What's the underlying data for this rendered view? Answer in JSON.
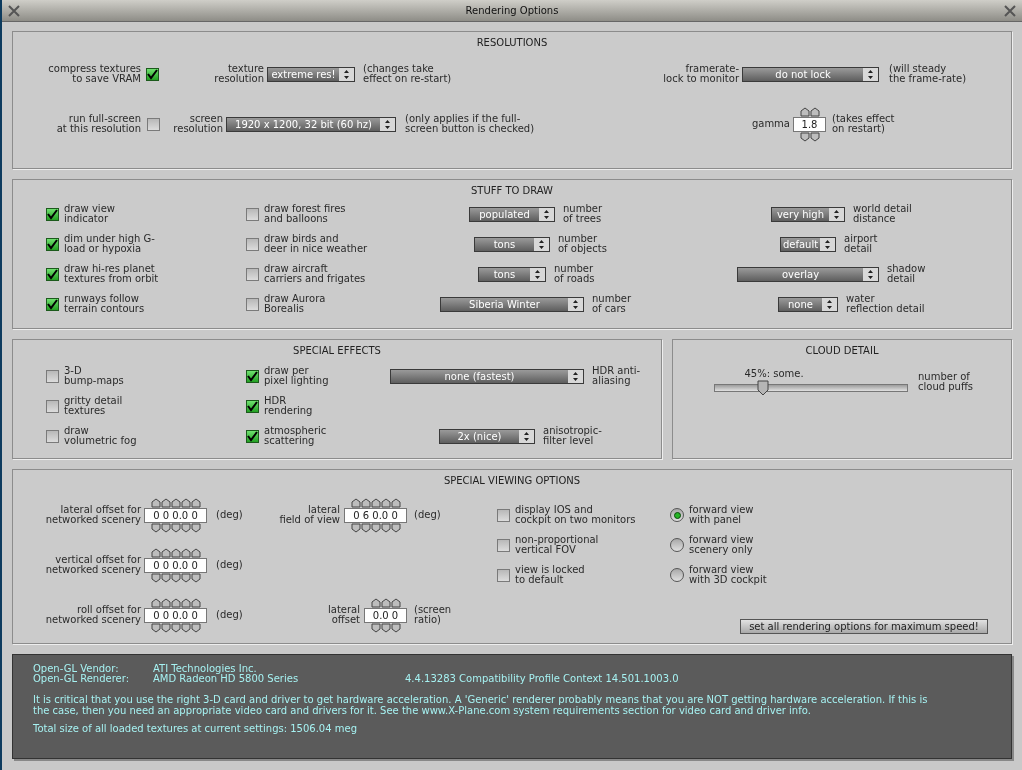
{
  "window": {
    "title": "Rendering Options"
  },
  "resolutions": {
    "title": "RESOLUTIONS",
    "compress_textures": {
      "label": "compress textures\nto save VRAM",
      "checked": true
    },
    "texture_resolution": {
      "label": "texture\nresolution",
      "value": "extreme res!",
      "note": "(changes take\neffect on re-start)"
    },
    "framerate_lock": {
      "label": "framerate-\nlock to monitor",
      "value": "do not lock",
      "note": "(will steady\nthe frame-rate)"
    },
    "run_full_screen": {
      "label": "run full-screen\nat this resolution",
      "checked": false
    },
    "screen_resolution": {
      "label": "screen\nresolution",
      "value": "1920 x 1200, 32 bit (60 hz)",
      "note": "(only applies if the full-\nscreen button is checked)"
    },
    "gamma": {
      "label": "gamma",
      "value": "1.8",
      "note": "(takes effect\non restart)"
    }
  },
  "stuff_to_draw": {
    "title": "STUFF TO DRAW",
    "options_1": [
      {
        "label": "draw view\nindicator",
        "checked": true
      },
      {
        "label": "dim under high G-\nload or hypoxia",
        "checked": true
      },
      {
        "label": "draw hi-res planet\ntextures from orbit",
        "checked": true
      },
      {
        "label": "runways follow\nterrain contours",
        "checked": true
      }
    ],
    "options_2": [
      {
        "label": "draw forest fires\nand balloons",
        "checked": false
      },
      {
        "label": "draw birds and\ndeer in nice weather",
        "checked": false
      },
      {
        "label": "draw aircraft\ncarriers and frigates",
        "checked": false
      },
      {
        "label": "draw Aurora\nBorealis",
        "checked": false
      }
    ],
    "settings_1": [
      {
        "value": "populated",
        "label": "number\nof trees"
      },
      {
        "value": "tons",
        "label": "number\nof objects"
      },
      {
        "value": "tons",
        "label": "number\nof roads"
      },
      {
        "value": "Siberia Winter",
        "label": "number\nof cars"
      }
    ],
    "settings_2": [
      {
        "value": "very high",
        "label": "world detail\ndistance"
      },
      {
        "value": "default",
        "label": "airport\ndetail"
      },
      {
        "value": "overlay",
        "label": "shadow\ndetail"
      },
      {
        "value": "none",
        "label": "water\nreflection detail"
      }
    ]
  },
  "special_effects": {
    "title": "SPECIAL EFFECTS",
    "options_1": [
      {
        "label": "3-D\nbump-maps",
        "checked": false
      },
      {
        "label": "gritty detail\ntextures",
        "checked": false
      },
      {
        "label": "draw\nvolumetric fog",
        "checked": false
      }
    ],
    "options_2": [
      {
        "label": "draw per\npixel lighting",
        "checked": true
      },
      {
        "label": "HDR\nrendering",
        "checked": true
      },
      {
        "label": "atmospheric\nscattering",
        "checked": true
      }
    ],
    "settings": [
      {
        "value": "none (fastest)",
        "label": "HDR anti-\naliasing"
      },
      {
        "value": "2x (nice)",
        "label": "anisotropic-\nfilter level"
      }
    ]
  },
  "cloud_detail": {
    "title": "CLOUD DETAIL",
    "reading": "45%: some.",
    "level": 0.25,
    "label": "number of\ncloud puffs"
  },
  "viewing_options": {
    "title": "SPECIAL VIEWING OPTIONS",
    "offsets": [
      {
        "label": "lateral offset for\nnetworked scenery",
        "value": "0 0 0.0 0",
        "unit": "(deg)"
      },
      {
        "label": "vertical offset for\nnetworked scenery",
        "value": "0 0 0.0 0",
        "unit": "(deg)"
      },
      {
        "label": "roll offset for\nnetworked scenery",
        "value": "0 0 0.0 0",
        "unit": "(deg)"
      }
    ],
    "lateral_fov": {
      "label": "lateral\nfield of view",
      "value": "0 6 0.0 0",
      "unit": "(deg)"
    },
    "lateral_offset": {
      "label": "lateral\noffset",
      "value": "0.0 0",
      "unit": "(screen\nratio)"
    },
    "options": [
      {
        "label": "display IOS and\ncockpit on two monitors",
        "checked": false
      },
      {
        "label": "non-proportional\nvertical FOV",
        "checked": false
      },
      {
        "label": "view is locked\nto default",
        "checked": false
      }
    ],
    "views": [
      {
        "label": "forward view\nwith panel",
        "selected": true
      },
      {
        "label": "forward view\nscenery only",
        "selected": false
      },
      {
        "label": "forward view\nwith 3D cockpit",
        "selected": false
      }
    ],
    "button": "set all rendering options for maximum speed!"
  },
  "info": {
    "vendor_label": "Open-GL Vendor:",
    "vendor": "ATI Technologies Inc.",
    "renderer_label": "Open-GL Renderer:",
    "renderer": "AMD Radeon HD 5800 Series",
    "version": "4.4.13283 Compatibility Profile Context 14.501.1003.0",
    "warning": "It is critical that you use the right 3-D card and driver to get hardware acceleration. A 'Generic' renderer probably means that you are NOT getting hardware acceleration. If this is\nthe case, then you need an appropriate video card and drivers for it. See the www.X-Plane.com system requirements section for video card and driver info.",
    "textures": "Total size of all loaded textures at current settings: 1506.04 meg"
  }
}
